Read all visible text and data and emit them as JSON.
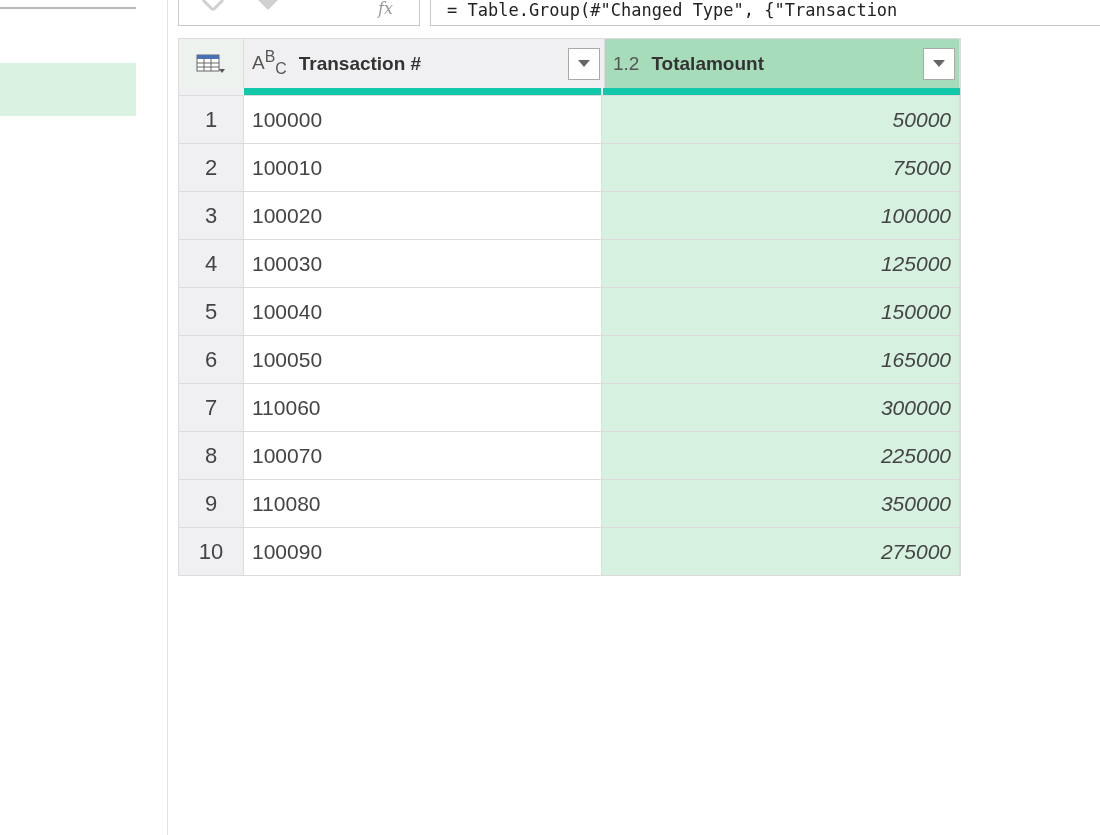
{
  "sidebar": {
    "items": [
      {
        "selected": true
      }
    ]
  },
  "formula_bar": {
    "fx": "fx",
    "formula": "= Table.Group(#\"Changed Type\", {\"Transaction"
  },
  "table": {
    "columns": [
      {
        "type_label": "A$^{B}$$_{C}$",
        "name": "Transaction #",
        "selected": false,
        "kind": "text"
      },
      {
        "type_label": "1.2",
        "name": "Totalamount",
        "selected": true,
        "kind": "number"
      }
    ],
    "rows": [
      {
        "index": "1",
        "cells": [
          "100000",
          "50000"
        ]
      },
      {
        "index": "2",
        "cells": [
          "100010",
          "75000"
        ]
      },
      {
        "index": "3",
        "cells": [
          "100020",
          "100000"
        ]
      },
      {
        "index": "4",
        "cells": [
          "100030",
          "125000"
        ]
      },
      {
        "index": "5",
        "cells": [
          "100040",
          "150000"
        ]
      },
      {
        "index": "6",
        "cells": [
          "100050",
          "165000"
        ]
      },
      {
        "index": "7",
        "cells": [
          "110060",
          "300000"
        ]
      },
      {
        "index": "8",
        "cells": [
          "100070",
          "225000"
        ]
      },
      {
        "index": "9",
        "cells": [
          "110080",
          "350000"
        ]
      },
      {
        "index": "10",
        "cells": [
          "100090",
          "275000"
        ]
      }
    ]
  }
}
